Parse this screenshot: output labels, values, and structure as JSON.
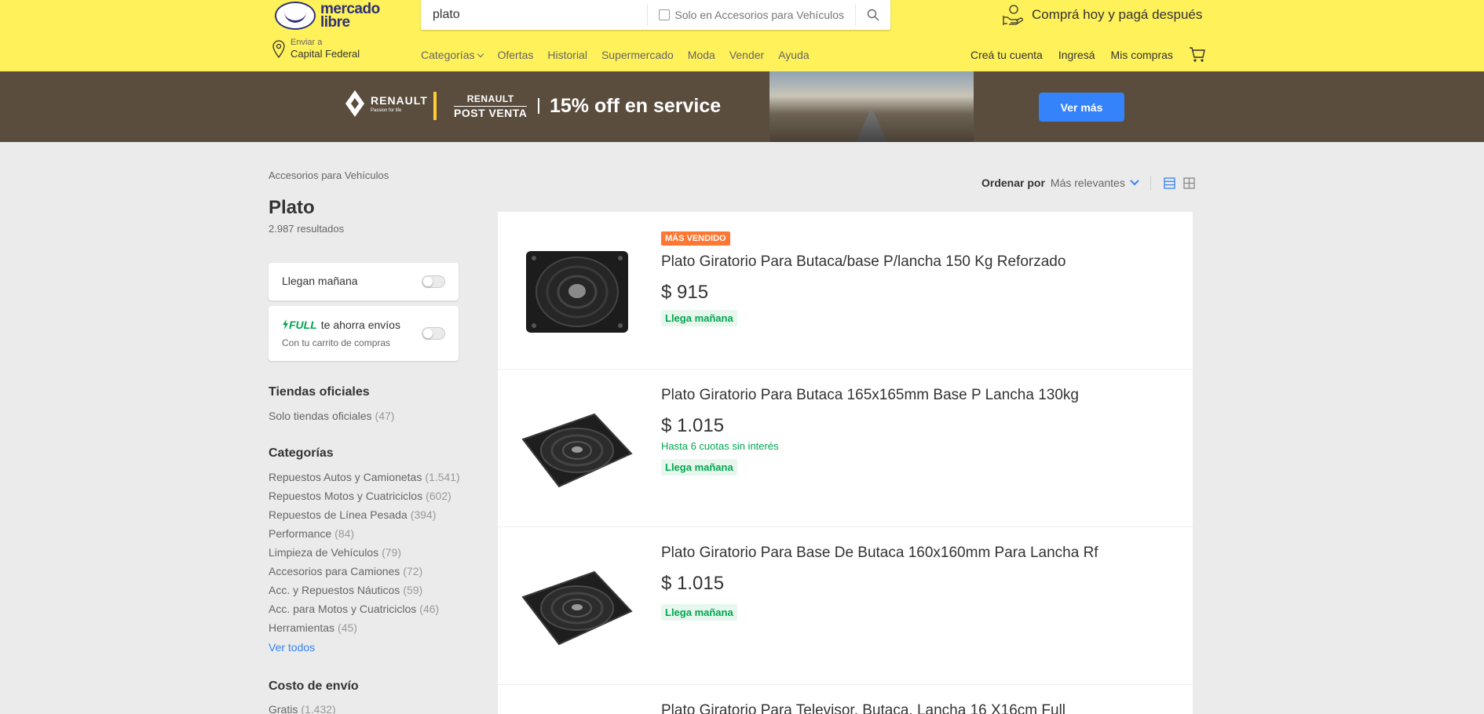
{
  "header": {
    "logo_line1": "mercado",
    "logo_line2": "libre",
    "search_value": "plato",
    "search_filter_label": "Solo en Accesorios para Vehículos",
    "promo_text": "Comprá hoy y pagá después",
    "location_label": "Enviar a",
    "location_value": "Capital Federal",
    "nav": [
      "Categorías",
      "Ofertas",
      "Historial",
      "Supermercado",
      "Moda",
      "Vender",
      "Ayuda"
    ],
    "user_nav": {
      "create_account": "Creá tu cuenta",
      "login": "Ingresá",
      "purchases": "Mis compras"
    },
    "colors": {
      "header_bg": "#fff159",
      "accent": "#3483fa"
    }
  },
  "banner": {
    "brand": "RENAULT",
    "brand_tagline": "Passion for life",
    "post_venta_top": "RENAULT",
    "post_venta_bottom": "POST VENTA",
    "title": "15% off en service",
    "button": "Ver más"
  },
  "sidebar": {
    "breadcrumb": "Accesorios para Vehículos",
    "title": "Plato",
    "results": "2.987 resultados",
    "filter_tomorrow": "Llegan mañana",
    "full_word": "FULL",
    "full_text": "te ahorra envíos",
    "full_sub": "Con tu carrito de compras",
    "official_title": "Tiendas oficiales",
    "official_item": {
      "label": "Solo tiendas oficiales",
      "count": "(47)"
    },
    "categories_title": "Categorías",
    "categories": [
      {
        "label": "Repuestos Autos y Camionetas",
        "count": "(1.541)"
      },
      {
        "label": "Repuestos Motos y Cuatriciclos",
        "count": "(602)"
      },
      {
        "label": "Repuestos de Línea Pesada",
        "count": "(394)"
      },
      {
        "label": "Performance",
        "count": "(84)"
      },
      {
        "label": "Limpieza de Vehículos",
        "count": "(79)"
      },
      {
        "label": "Accesorios para Camiones",
        "count": "(72)"
      },
      {
        "label": "Acc. y Repuestos Náuticos",
        "count": "(59)"
      },
      {
        "label": "Acc. para Motos y Cuatriciclos",
        "count": "(46)"
      },
      {
        "label": "Herramientas",
        "count": "(45)"
      }
    ],
    "see_all": "Ver todos",
    "shipping_title": "Costo de envío",
    "shipping_item": {
      "label": "Gratis",
      "count": "(1.432)"
    }
  },
  "sort": {
    "label": "Ordenar por",
    "value": "Más relevantes"
  },
  "items": [
    {
      "badge": "MÁS VENDIDO",
      "title": "Plato Giratorio Para Butaca/base P/lancha 150 Kg Reforzado",
      "price": "$ 915",
      "installments": "",
      "shipping": "Llega mañana"
    },
    {
      "badge": "",
      "title": "Plato Giratorio Para Butaca 165x165mm Base P Lancha 130kg",
      "price": "$ 1.015",
      "installments": "Hasta 6 cuotas sin interés",
      "shipping": "Llega mañana"
    },
    {
      "badge": "",
      "title": "Plato Giratorio Para Base De Butaca 160x160mm Para Lancha Rf",
      "price": "$ 1.015",
      "installments": "",
      "shipping": "Llega mañana"
    },
    {
      "badge": "",
      "title": "Plato Giratorio Para Televisor, Butaca, Lancha 16 X16cm Full",
      "price": "",
      "installments": "",
      "shipping": ""
    }
  ]
}
